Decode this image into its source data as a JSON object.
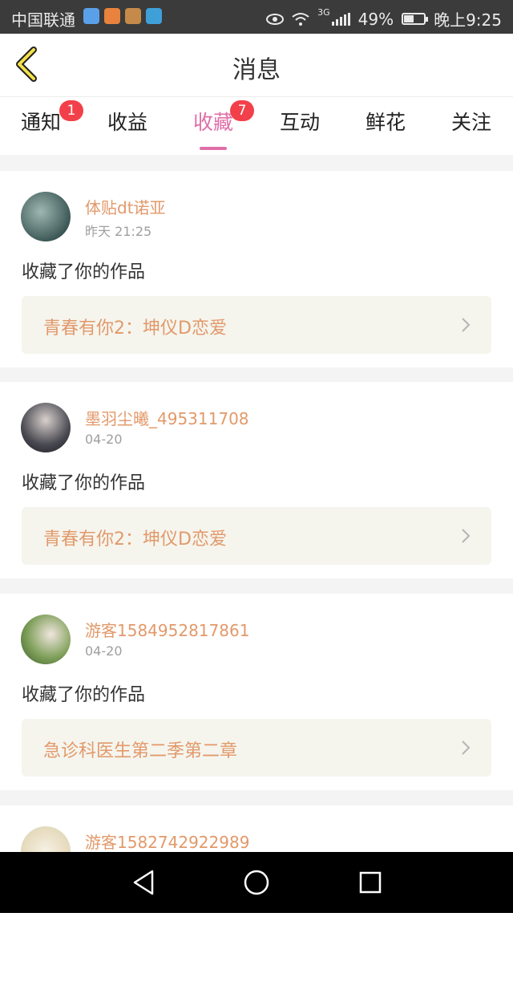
{
  "status_bar": {
    "carrier": "中国联通",
    "network": "3G",
    "battery": "49%",
    "battery_level": 0.49,
    "time": "晚上9:25"
  },
  "header": {
    "title": "消息"
  },
  "tabs": [
    {
      "label": "通知",
      "badge": "1"
    },
    {
      "label": "收益",
      "badge": ""
    },
    {
      "label": "收藏",
      "badge": "7",
      "active": true
    },
    {
      "label": "互动",
      "badge": ""
    },
    {
      "label": "鲜花",
      "badge": ""
    },
    {
      "label": "关注",
      "badge": ""
    }
  ],
  "messages": [
    {
      "user": "体贴dt诺亚",
      "time": "昨天 21:25",
      "action": "收藏了你的作品",
      "work": "青春有你2：坤仪D恋爱"
    },
    {
      "user": "墨羽尘曦_495311708",
      "time": "04-20",
      "action": "收藏了你的作品",
      "work": "青春有你2：坤仪D恋爱"
    },
    {
      "user": "游客1584952817861",
      "time": "04-20",
      "action": "收藏了你的作品",
      "work": "急诊科医生第二季第二章"
    },
    {
      "user": "游客1582742922989",
      "time": "",
      "action": "",
      "work": ""
    }
  ],
  "colors": {
    "accent_pink": "#e06fa8",
    "username_orange": "#e2996a",
    "badge_red": "#f2404a"
  }
}
